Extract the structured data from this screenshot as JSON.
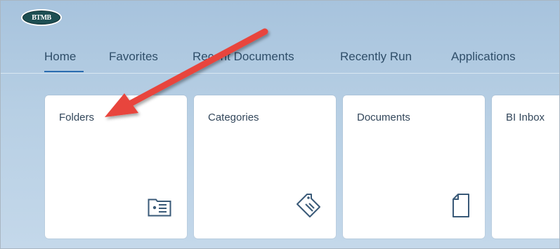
{
  "logo": {
    "text": "BTMB"
  },
  "tabs": [
    {
      "label": "Home",
      "active": true
    },
    {
      "label": "Favorites"
    },
    {
      "label": "Recent Documents"
    },
    {
      "label": "Recently Run"
    },
    {
      "label": "Applications"
    }
  ],
  "tiles": [
    {
      "title": "Folders",
      "icon": "folder-card-icon"
    },
    {
      "title": "Categories",
      "icon": "tag-icon"
    },
    {
      "title": "Documents",
      "icon": "document-icon"
    },
    {
      "title": "BI Inbox",
      "icon": ""
    }
  ],
  "colors": {
    "accent": "#2a6cb0",
    "annotation_arrow": "#e8453c",
    "tab_text": "#2f4e69",
    "icon": "#3a5a78"
  }
}
